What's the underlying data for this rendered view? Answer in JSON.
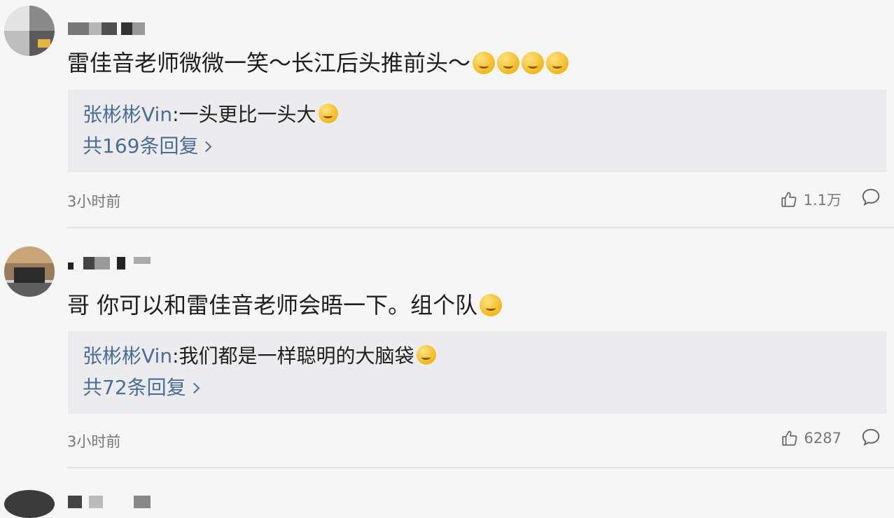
{
  "comments": [
    {
      "text": "雷佳音老师微微一笑～长江后头推前头～",
      "reply": {
        "name": "张彬彬Vin",
        "text": ":一头更比一头大",
        "count": "共169条回复"
      },
      "time": "3小时前",
      "likes": "1.1万",
      "emojis": [
        "cry-laugh",
        "cry-laugh",
        "cry-laugh",
        "cry-laugh"
      ]
    },
    {
      "text": "哥 你可以和雷佳音老师会晤一下。组个队",
      "reply": {
        "name": "张彬彬Vin",
        "text": ":我们都是一样聪明的大脑袋",
        "count": "共72条回复"
      },
      "time": "3小时前",
      "likes": "6287",
      "emojis": [
        "laughing"
      ]
    }
  ],
  "colors": {
    "background": "#f6f6f6",
    "reply_bg": "#ececee",
    "link_blue": "#4a6d97",
    "meta_gray": "#777777"
  }
}
